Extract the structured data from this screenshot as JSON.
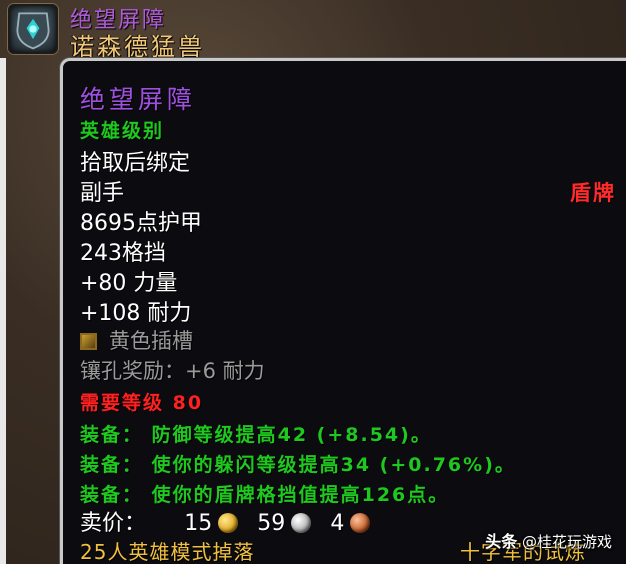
{
  "header": {
    "item_name": "绝望屏障",
    "boss_name": "诺森德猛兽",
    "icon": "shield-item-icon"
  },
  "tooltip": {
    "item_name": "绝望屏障",
    "quality": "英雄级别",
    "bind": "拾取后绑定",
    "slot": "副手",
    "type": "盾牌",
    "armor": "8695点护甲",
    "block": "243格挡",
    "stat_strength": "+80 力量",
    "stat_stamina": "+108 耐力",
    "socket_label": "黄色插槽",
    "socket_icon": "yellow-socket-icon",
    "socket_bonus": "镶孔奖励：+6 耐力",
    "required_level": "需要等级 80",
    "equip_lines": [
      "装备： 防御等级提高42 (+8.54)。",
      "装备： 使你的躲闪等级提高34 (+0.76%)。",
      "装备： 使你的盾牌格挡值提高126点。"
    ],
    "sell_label": "卖价：",
    "sell_gold": "15",
    "sell_silver": "59",
    "sell_copper": "4",
    "drop_source": "25人英雄模式掉落",
    "drop_location": "十字军的试炼"
  },
  "watermark": {
    "brand": "头条",
    "account": "@桂花玩游戏"
  },
  "colors": {
    "epic_purple": "#a050e0",
    "uncommon_green": "#1ec81e",
    "error_red": "#ff2020",
    "gold": "#f0c040"
  }
}
